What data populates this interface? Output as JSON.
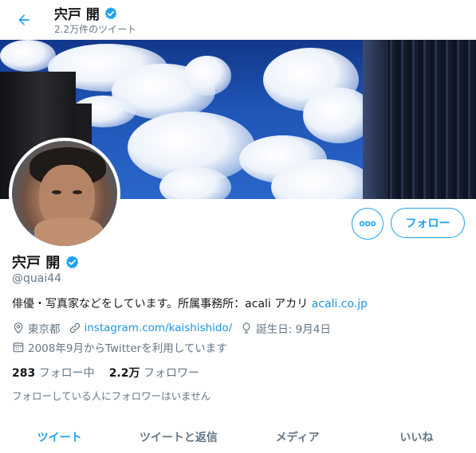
{
  "header": {
    "name": "宍戸 開",
    "tweet_count": "2.2万件のツイート"
  },
  "profile": {
    "name": "宍戸 開",
    "handle": "@quai44",
    "bio_text": "俳優・写真家などをしています。所属事務所：acali アカリ",
    "bio_link": "acali.co.jp",
    "location": "東京都",
    "website": "instagram.com/kaishishido/",
    "birthday": "誕生日: 9月4日",
    "joined": "2008年9月からTwitterを利用しています"
  },
  "actions": {
    "more_icon": "more-icon",
    "follow_label": "フォロー"
  },
  "stats": {
    "following_count": "283",
    "following_label": "フォロー中",
    "followers_count": "2.2万",
    "followers_label": "フォロワー"
  },
  "followers_note": "フォローしている人にフォロワーはいません",
  "tabs": [
    {
      "label": "ツイート",
      "active": true
    },
    {
      "label": "ツイートと返信",
      "active": false
    },
    {
      "label": "メディア",
      "active": false
    },
    {
      "label": "いいね",
      "active": false
    }
  ],
  "colors": {
    "accent": "#1da1f2",
    "link": "#1b95e0",
    "muted": "#657786",
    "text": "#14171a"
  },
  "icons": [
    "back-arrow-icon",
    "verified-badge-icon",
    "location-icon",
    "link-icon",
    "birthday-icon",
    "calendar-icon"
  ]
}
